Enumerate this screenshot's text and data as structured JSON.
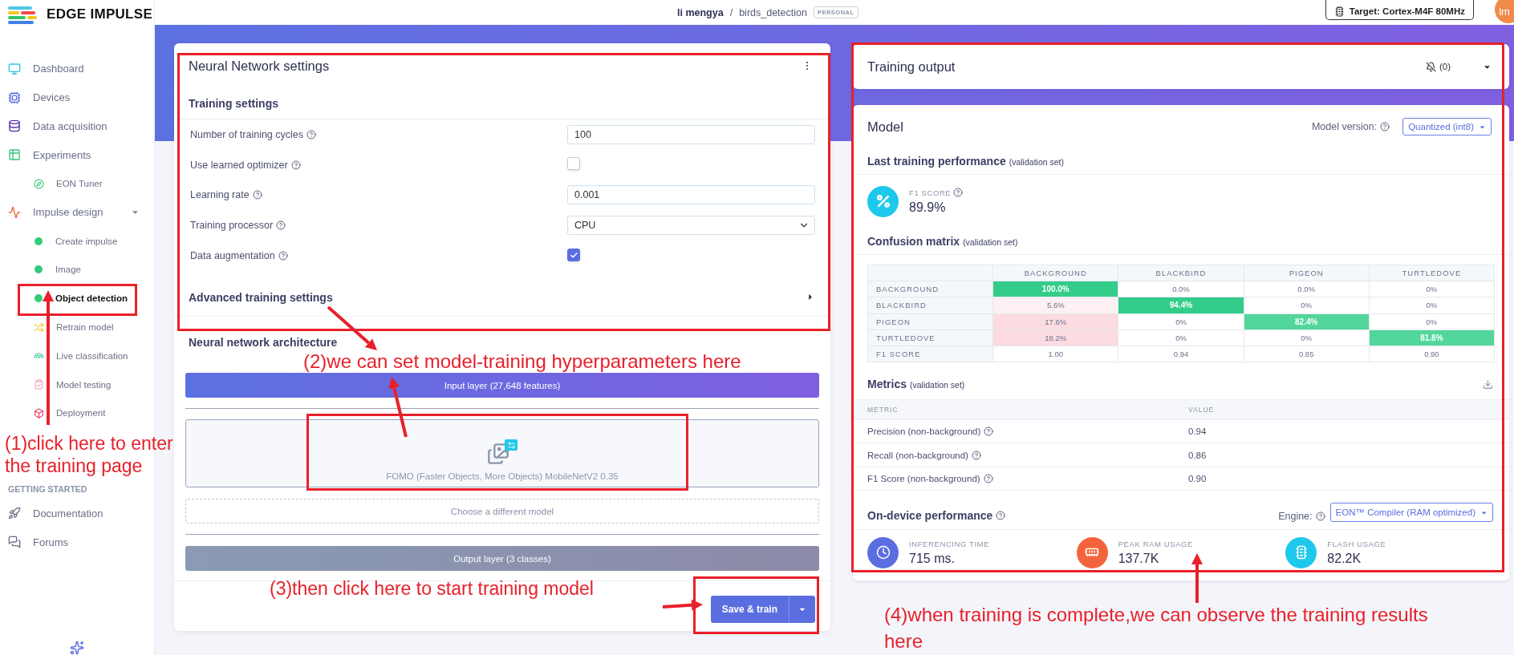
{
  "brand": "EDGE IMPULSE",
  "topbar": {
    "user": "li mengya",
    "separator": "/",
    "project": "birds_detection",
    "badge": "PERSONAL",
    "target": "Target: Cortex-M4F 80MHz",
    "avatar": "lm"
  },
  "sidebar": {
    "items": [
      {
        "label": "Dashboard",
        "kind": "icon",
        "selected": false
      },
      {
        "label": "Devices",
        "kind": "icon",
        "selected": false
      },
      {
        "label": "Data acquisition",
        "kind": "icon",
        "selected": false
      },
      {
        "label": "Experiments",
        "kind": "icon",
        "selected": false,
        "children": [
          {
            "label": "EON Tuner",
            "kind": "icon",
            "selected": false
          }
        ]
      },
      {
        "label": "Impulse design",
        "kind": "icon",
        "selected": false,
        "expanded": true,
        "children": [
          {
            "label": "Create impulse",
            "kind": "dot",
            "selected": false
          },
          {
            "label": "Image",
            "kind": "dot",
            "selected": false
          },
          {
            "label": "Object detection",
            "kind": "dot",
            "selected": true
          },
          {
            "label": "Retrain model",
            "kind": "icon",
            "selected": false
          },
          {
            "label": "Live classification",
            "kind": "icon",
            "selected": false
          },
          {
            "label": "Model testing",
            "kind": "icon",
            "selected": false
          },
          {
            "label": "Deployment",
            "kind": "icon",
            "selected": false
          }
        ]
      }
    ],
    "section": "GETTING STARTED",
    "links": [
      {
        "label": "Documentation",
        "kind": "icon",
        "selected": false
      },
      {
        "label": "Forums",
        "kind": "icon",
        "selected": false
      }
    ]
  },
  "nn_settings": {
    "title": "Neural Network settings",
    "training_title": "Training settings",
    "fields": [
      {
        "kind": "input",
        "label": "Number of training cycles",
        "value": "100"
      },
      {
        "kind": "checkbox",
        "label": "Use learned optimizer",
        "checked": false
      },
      {
        "kind": "input",
        "label": "Learning rate",
        "value": "0.001"
      },
      {
        "kind": "select",
        "label": "Training processor",
        "value": "CPU"
      },
      {
        "kind": "checkbox",
        "label": "Data augmentation",
        "checked": true
      }
    ],
    "advanced": {
      "title": "Advanced training settings",
      "expanded": false
    },
    "architecture": {
      "title": "Neural network architecture",
      "input_layer": "Input layer (27,648 features)",
      "model": "FOMO (Faster Objects, More Objects) MobileNetV2 0.35",
      "choose": "Choose a different model",
      "output_layer": "Output layer (3 classes)"
    },
    "save_button": "Save & train"
  },
  "training_output": {
    "title": "Training output",
    "notifications": "(0)"
  },
  "model": {
    "title": "Model",
    "version_label": "Model version:",
    "version": "Quantized (int8)",
    "performance": {
      "title": "Last training performance",
      "note": "(validation set)",
      "label": "F1 SCORE",
      "value": "89.9%"
    },
    "confusion": {
      "title": "Confusion matrix",
      "note": "(validation set)",
      "columns": [
        "BACKGROUND",
        "BLACKBIRD",
        "PIGEON",
        "TURTLEDOVE"
      ],
      "rows": [
        {
          "label": "BACKGROUND",
          "cells": [
            {
              "value": "100.0%",
              "color": "#33cc8a"
            },
            {
              "value": "0.0%"
            },
            {
              "value": "0.0%"
            },
            {
              "value": "0%"
            }
          ]
        },
        {
          "label": "BLACKBIRD",
          "cells": [
            {
              "value": "5.6%",
              "color": "#fdf1f3"
            },
            {
              "value": "94.4%",
              "color": "#33cc8a"
            },
            {
              "value": "0%"
            },
            {
              "value": "0%"
            }
          ]
        },
        {
          "label": "PIGEON",
          "cells": [
            {
              "value": "17.6%",
              "color": "#fcdbe1"
            },
            {
              "value": "0%"
            },
            {
              "value": "82.4%",
              "color": "#52d69c"
            },
            {
              "value": "0%"
            }
          ]
        },
        {
          "label": "TURTLEDOVE",
          "cells": [
            {
              "value": "18.2%",
              "color": "#fcdbe1"
            },
            {
              "value": "0%"
            },
            {
              "value": "0%"
            },
            {
              "value": "81.8%",
              "color": "#52d69c"
            }
          ]
        },
        {
          "label": "F1 SCORE",
          "cells": [
            {
              "value": "1.00"
            },
            {
              "value": "0.94"
            },
            {
              "value": "0.85"
            },
            {
              "value": "0.90"
            }
          ]
        }
      ]
    },
    "metrics": {
      "title": "Metrics",
      "note": "(validation set)",
      "columns": [
        "METRIC",
        "VALUE"
      ],
      "rows": [
        {
          "metric": "Precision (non-background)",
          "value": "0.94"
        },
        {
          "metric": "Recall (non-background)",
          "value": "0.86"
        },
        {
          "metric": "F1 Score (non-background)",
          "value": "0.90"
        }
      ]
    },
    "on_device": {
      "title": "On-device performance",
      "engine_label": "Engine:",
      "engine": "EON™ Compiler (RAM optimized)",
      "stats": [
        {
          "label": "INFERENCING TIME",
          "value": "715 ms.",
          "color": "#5b6ee0"
        },
        {
          "label": "PEAK RAM USAGE",
          "value": "137.7K",
          "color": "#f4643c"
        },
        {
          "label": "FLASH USAGE",
          "value": "82.2K",
          "color": "#1ec8ec"
        }
      ]
    }
  },
  "annotations": [
    {
      "text": "(1)click here to enter the training page"
    },
    {
      "text": "(2)we can set model-training hyperparameters here"
    },
    {
      "text": "(3)then click here to start training model"
    },
    {
      "text": "(4)when training is complete,we can observe the training results here"
    }
  ]
}
